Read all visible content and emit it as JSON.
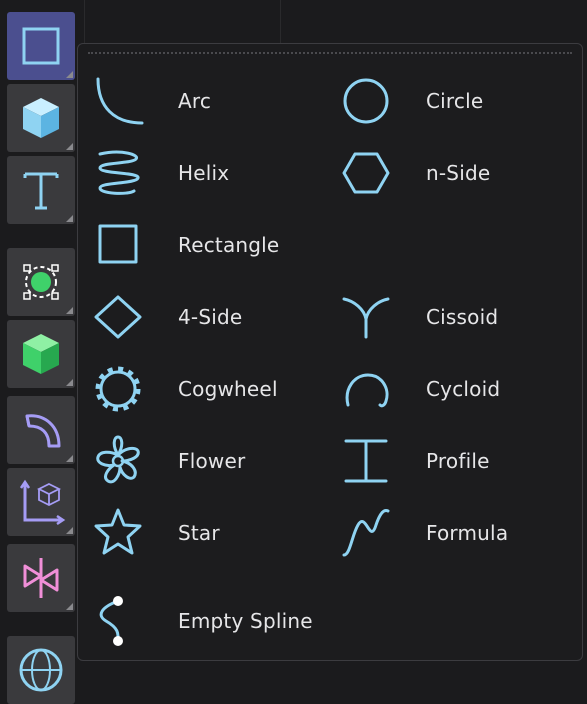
{
  "palette": {
    "tools": [
      {
        "name": "primitive-shape-tool",
        "icon": "square-outline-icon",
        "active": true
      },
      {
        "name": "primitive-solid-tool",
        "icon": "cube-icon"
      },
      {
        "name": "text-tool",
        "icon": "text-t-icon"
      },
      {
        "name": "selection-tool",
        "icon": "selection-point-icon"
      },
      {
        "name": "generator-tool",
        "icon": "green-cube-icon"
      },
      {
        "name": "deformer-tool",
        "icon": "bend-icon"
      },
      {
        "name": "axis-tool",
        "icon": "axis-cube-icon"
      },
      {
        "name": "mograph-tool",
        "icon": "pink-shape-icon"
      },
      {
        "name": "environment-tool",
        "icon": "globe-icon"
      }
    ]
  },
  "menu": {
    "items": [
      {
        "label": "Arc",
        "icon": "arc-icon"
      },
      {
        "label": "Circle",
        "icon": "circle-icon"
      },
      {
        "label": "Helix",
        "icon": "helix-icon"
      },
      {
        "label": "n-Side",
        "icon": "hexagon-icon"
      },
      {
        "label": "Rectangle",
        "icon": "rectangle-icon"
      },
      {
        "label": "4-Side",
        "icon": "diamond-icon"
      },
      {
        "label": "Cissoid",
        "icon": "cissoid-icon"
      },
      {
        "label": "Cogwheel",
        "icon": "cogwheel-icon"
      },
      {
        "label": "Cycloid",
        "icon": "cycloid-icon"
      },
      {
        "label": "Flower",
        "icon": "flower-icon"
      },
      {
        "label": "Profile",
        "icon": "profile-icon"
      },
      {
        "label": "Star",
        "icon": "star-icon"
      },
      {
        "label": "Formula",
        "icon": "formula-icon"
      },
      {
        "label": "Empty Spline",
        "icon": "empty-spline-icon"
      }
    ]
  },
  "colors": {
    "accent": "#8fd3f2",
    "active_tool": "#4b4f8f",
    "menu_bg": "#1c1c1e"
  }
}
